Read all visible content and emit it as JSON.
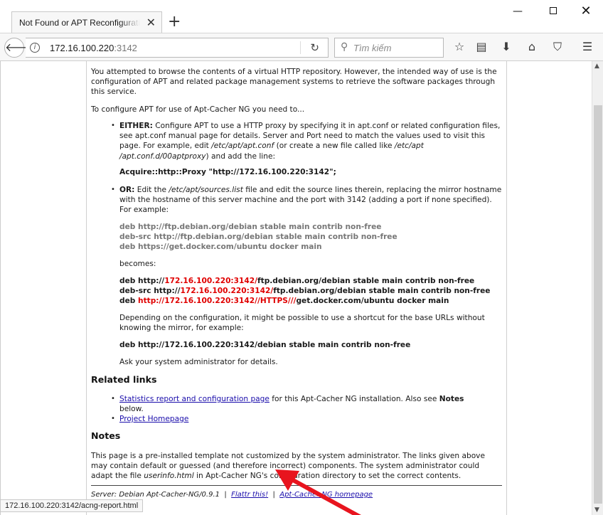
{
  "browser": {
    "tab_title": "Not Found or APT Reconfiguration",
    "url_host": "172.16.100.220",
    "url_port": ":3142",
    "search_placeholder": "Tìm kiếm",
    "status_url": "172.16.100.220:3142/acng-report.html"
  },
  "page": {
    "intro": "You attempted to browse the contents of a virtual HTTP repository. However, the intended way of use is the configuration of APT and related package management systems to retrieve the software packages through this service.",
    "configure_intro": "To configure APT for use of Apt-Cacher NG you need to...",
    "either_label": "EITHER:",
    "either_text_1": " Configure APT to use a HTTP proxy by specifying it in apt.conf or related configuration files, see apt.conf manual page for details. Server and Port need to match the values used to visit this page. For example, edit ",
    "either_path_1": "/etc/apt/apt.conf",
    "either_text_2": " (or create a new file called like ",
    "either_path_2": "/etc/apt /apt.conf.d/00aptproxy",
    "either_text_3": ") and add the line:",
    "proxy_line": "Acquire::http::Proxy \"http://172.16.100.220:3142\";",
    "or_label": "OR:",
    "or_text_1": " Edit the ",
    "or_path": "/etc/apt/sources.list",
    "or_text_2": " file and edit the source lines therein, replacing the mirror hostname with the hostname of this server machine and the port with 3142 (adding a port if none specified). For example:",
    "example_lines": [
      "deb http://ftp.debian.org/debian stable main contrib non-free",
      "deb-src http://ftp.debian.org/debian stable main contrib non-free",
      "deb https://get.docker.com/ubuntu docker main"
    ],
    "becomes": "becomes:",
    "new_line_1_a": "deb http://",
    "new_line_1_b": "172.16.100.220:3142/",
    "new_line_1_c": "ftp.debian.org/debian stable main contrib non-free",
    "new_line_2_a": "deb-src http://",
    "new_line_2_b": "172.16.100.220:3142/",
    "new_line_2_c": "ftp.debian.org/debian stable main contrib non-free",
    "new_line_3_a": "deb ",
    "new_line_3_b": "http://172.16.100.220:3142//HTTPS///",
    "new_line_3_c": "get.docker.com/ubuntu docker main",
    "shortcut_text": "Depending on the configuration, it might be possible to use a shortcut for the base URLs without knowing the mirror, for example:",
    "shortcut_line": "deb http://172.16.100.220:3142/debian stable main contrib non-free",
    "ask_admin": "Ask your system administrator for details.",
    "related_heading": "Related links",
    "stats_link": "Statistics report and configuration page",
    "stats_text_1": " for this Apt-Cacher NG installation. Also see ",
    "stats_notes": "Notes",
    "stats_text_2": "below.",
    "project_link": "Project Homepage",
    "notes_heading": "Notes",
    "notes_text_1": "This page is a pre-installed template not customized by the system administrator. The links given above may contain default or guessed (and therefore incorrect) components. The system administrator could adapt the file ",
    "notes_file": "userinfo.html",
    "notes_text_2": " in Apt-Cacher NG's configuration directory to set the correct contents.",
    "footer_server": "Server: Debian Apt-Cacher-NG/0.9.1",
    "footer_sep": "|",
    "footer_flattr": "Flattr this!",
    "footer_homepage": "Apt-Cacher NG homepage"
  },
  "colors": {
    "annotation_arrow": "#e8141e",
    "highlight_red": "#e00000"
  }
}
